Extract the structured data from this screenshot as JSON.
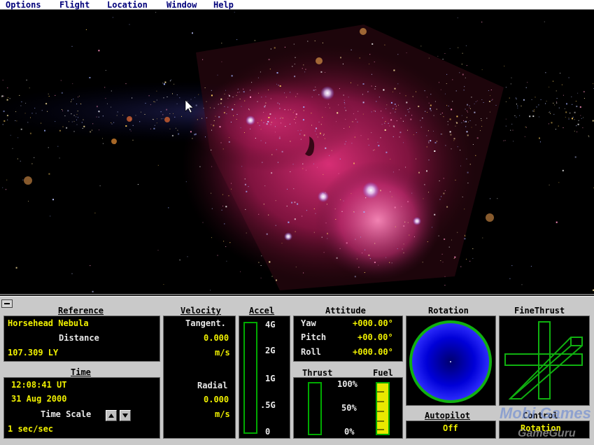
{
  "menu": [
    "Options",
    "Flight",
    "Location",
    "Window",
    "Help"
  ],
  "reference": {
    "title": "Reference",
    "name": "Horsehead Nebula",
    "distance_label": "Distance",
    "distance": "107.309 LY"
  },
  "time": {
    "title": "Time",
    "clock": "12:08:41 UT",
    "date": "31 Aug 2000",
    "scale_label": "Time Scale",
    "scale": "1 sec/sec"
  },
  "velocity": {
    "title": "Velocity",
    "tangent_label": "Tangent.",
    "tangent": "0.000",
    "tangent_unit": "m/s",
    "radial_label": "Radial",
    "radial": "0.000",
    "radial_unit": "m/s"
  },
  "accel": {
    "title": "Accel",
    "ticks": [
      "4G",
      "2G",
      "1G",
      ".5G",
      "0"
    ]
  },
  "attitude": {
    "title": "Attitude",
    "yaw_label": "Yaw",
    "yaw": "+000.00°",
    "pitch_label": "Pitch",
    "pitch": "+00.00°",
    "roll_label": "Roll",
    "roll": "+000.00°"
  },
  "thrust": {
    "title": "Thrust",
    "ticks": [
      "100%",
      "50%",
      "0%"
    ],
    "level": 0
  },
  "fuel": {
    "title": "Fuel",
    "level": 1.0
  },
  "rotation": {
    "title": "Rotation"
  },
  "finethrust": {
    "title": "FineThrust"
  },
  "autopilot": {
    "title": "Autopilot",
    "value": "Off"
  },
  "control": {
    "title": "Control",
    "value": "Rotation"
  },
  "colors": {
    "panel": "#c9c9c9",
    "value_yellow": "#f0f000",
    "gauge_green": "#00aa00",
    "rotation_blue": "#1a1aff",
    "menu_text": "#00007a"
  },
  "watermark": {
    "line1": "Mobi Games",
    "line2": "GameGuru"
  }
}
